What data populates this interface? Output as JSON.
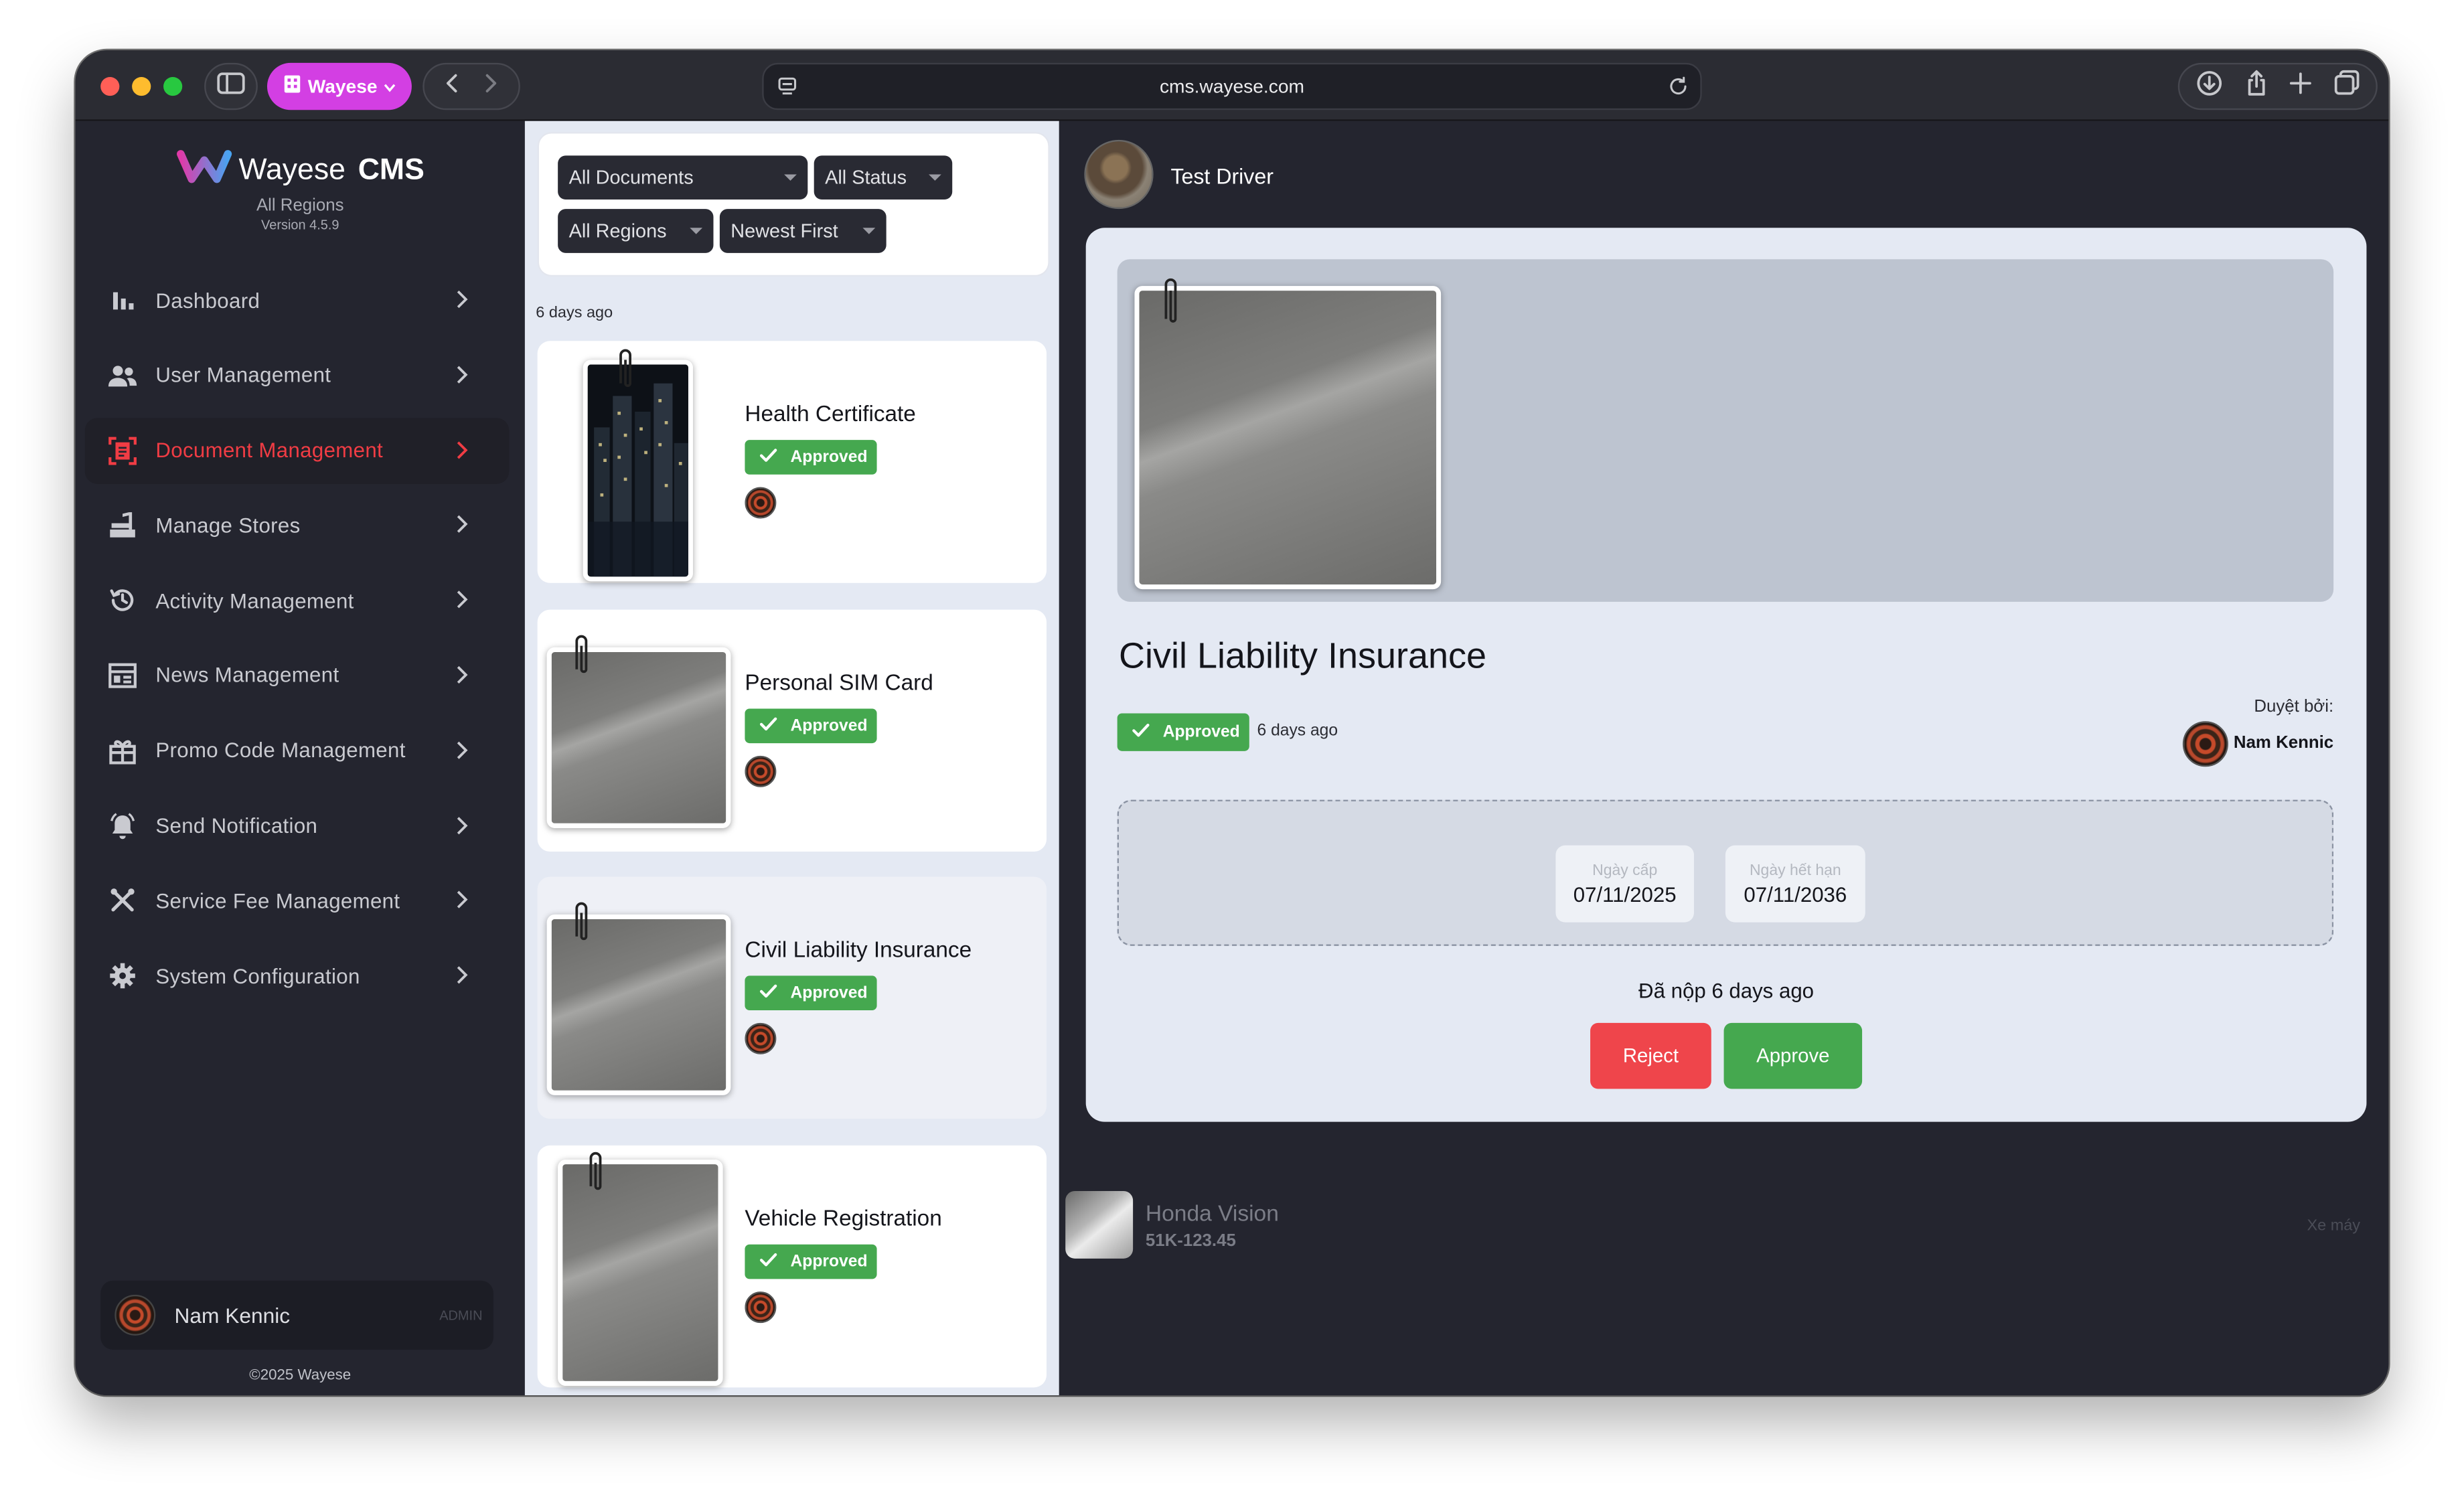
{
  "browser": {
    "workspace_label": "Wayese",
    "url": "cms.wayese.com"
  },
  "brand": {
    "name": "Wayese",
    "product": "CMS",
    "region": "All Regions",
    "version": "Version 4.5.9",
    "colors": {
      "logo_gradient": [
        "#e03aa8",
        "#4aa3f0"
      ],
      "accent": "#f03c44"
    }
  },
  "sidebar": {
    "items": [
      {
        "label": "Dashboard",
        "icon": "bar-chart-icon",
        "active": false
      },
      {
        "label": "User Management",
        "icon": "users-icon",
        "active": false
      },
      {
        "label": "Document Management",
        "icon": "document-scan-icon",
        "active": true
      },
      {
        "label": "Manage Stores",
        "icon": "store-icon",
        "active": false
      },
      {
        "label": "Activity Management",
        "icon": "history-icon",
        "active": false
      },
      {
        "label": "News Management",
        "icon": "newspaper-icon",
        "active": false
      },
      {
        "label": "Promo Code Management",
        "icon": "gift-icon",
        "active": false
      },
      {
        "label": "Send Notification",
        "icon": "bell-icon",
        "active": false
      },
      {
        "label": "Service Fee Management",
        "icon": "tools-icon",
        "active": false
      },
      {
        "label": "System Configuration",
        "icon": "gear-icon",
        "active": false
      }
    ],
    "user": {
      "name": "Nam Kennic",
      "role": "ADMIN"
    },
    "copyright": "©2025 Wayese"
  },
  "filters": {
    "documents": "All Documents",
    "status": "All Status",
    "regions": "All Regions",
    "sort": "Newest First"
  },
  "list": {
    "group_label": "6 days ago",
    "cards": [
      {
        "title": "Health Certificate",
        "status": "Approved",
        "selected": false
      },
      {
        "title": "Personal SIM Card",
        "status": "Approved",
        "selected": false
      },
      {
        "title": "Civil Liability Insurance",
        "status": "Approved",
        "selected": true
      },
      {
        "title": "Vehicle Registration",
        "status": "Approved",
        "selected": false
      }
    ]
  },
  "detail": {
    "driver_name": "Test Driver",
    "doc_title": "Civil Liability Insurance",
    "status": "Approved",
    "status_time": "6 days ago",
    "approved_by_label": "Duyệt bởi:",
    "approved_by": "Nam Kennic",
    "issue_date_label": "Ngày cấp",
    "issue_date": "07/11/2025",
    "expiry_date_label": "Ngày hết hạn",
    "expiry_date": "07/11/2036",
    "submitted": "Đã nộp 6 days ago",
    "reject_label": "Reject",
    "approve_label": "Approve",
    "colors": {
      "approved": "#45a84f",
      "reject": "#ef454b",
      "approve": "#45a84f"
    }
  },
  "vehicle": {
    "name": "Honda Vision",
    "plate": "51K-123.45",
    "type": "Xe máy"
  }
}
